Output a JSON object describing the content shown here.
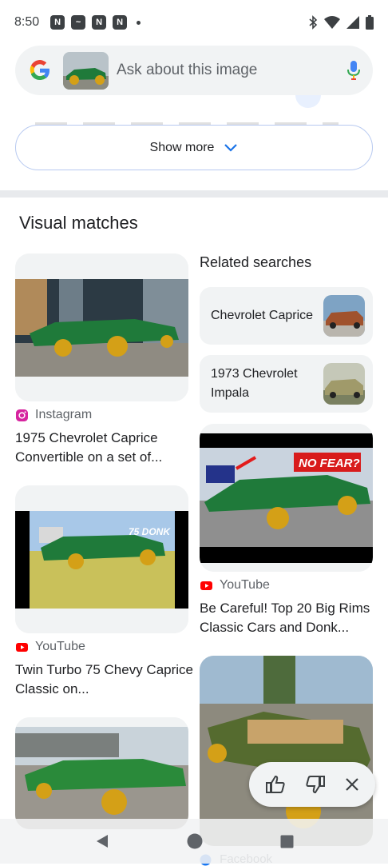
{
  "status_bar": {
    "time": "8:50"
  },
  "search": {
    "placeholder": "Ask about this image"
  },
  "show_more": {
    "label": "Show more"
  },
  "visual_matches": {
    "title": "Visual matches",
    "left": [
      {
        "source": "Instagram",
        "caption": "1975 Chevrolet Caprice Convertible on a set of..."
      },
      {
        "source": "YouTube",
        "caption": "Twin Turbo 75 Chevy Caprice Classic on..."
      }
    ],
    "right": [
      {
        "source": "YouTube",
        "caption": "Be Careful! Top 20 Big Rims Classic Cars and Donk...",
        "overlay_text": "NO FEAR?"
      },
      {
        "source": "Facebook"
      }
    ],
    "thumb_overlay_text": "75 DONK"
  },
  "related": {
    "title": "Related searches",
    "items": [
      {
        "label": "Chevrolet Caprice"
      },
      {
        "label": "1973 Chevrolet Impala"
      }
    ]
  },
  "colors": {
    "accent": "#1a73e8",
    "youtube": "#ff0000",
    "car_green": "#1f7a3a",
    "gold_rim": "#d4a017"
  }
}
